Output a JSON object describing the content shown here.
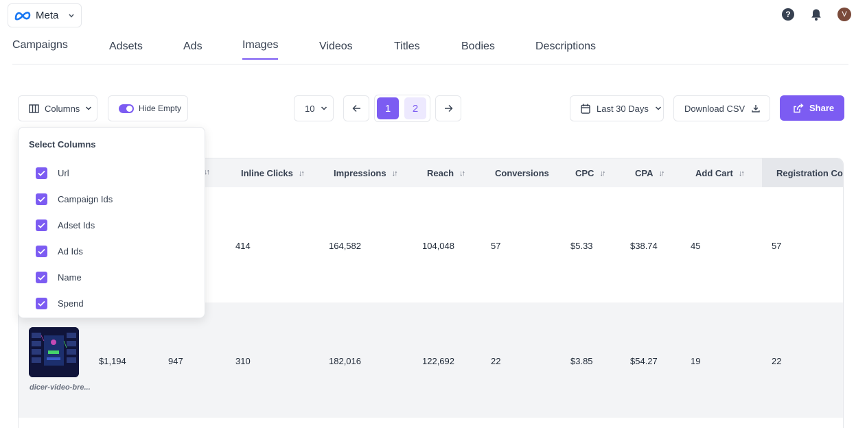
{
  "brand": {
    "name": "Meta"
  },
  "header": {
    "avatar_initial": "V",
    "help_glyph": "?"
  },
  "tabs": [
    {
      "label": "Campaigns"
    },
    {
      "label": "Adsets"
    },
    {
      "label": "Ads"
    },
    {
      "label": "Images",
      "active": true
    },
    {
      "label": "Videos"
    },
    {
      "label": "Titles"
    },
    {
      "label": "Bodies"
    },
    {
      "label": "Descriptions"
    }
  ],
  "toolbar": {
    "columns_label": "Columns",
    "hide_empty_label": "Hide Empty",
    "hide_empty_on": true,
    "per_page": "10",
    "pages": [
      "1",
      "2"
    ],
    "current_page": "1",
    "date_range": "Last 30 Days",
    "download_label": "Download CSV",
    "share_label": "Share"
  },
  "columns_dropdown": {
    "title": "Select Columns",
    "items": [
      {
        "label": "Url",
        "checked": true
      },
      {
        "label": "Campaign Ids",
        "checked": true
      },
      {
        "label": "Adset Ids",
        "checked": true
      },
      {
        "label": "Ad Ids",
        "checked": true
      },
      {
        "label": "Name",
        "checked": true
      },
      {
        "label": "Spend",
        "checked": true
      }
    ]
  },
  "table": {
    "headers": [
      "Inline Clicks",
      "Impressions",
      "Reach",
      "Conversions",
      "CPC",
      "CPA",
      "Add Cart",
      "Registration Cor"
    ],
    "rows": [
      {
        "spend": "",
        "col3": "",
        "inline_clicks": "414",
        "impressions": "164,582",
        "reach": "104,048",
        "conversions": "57",
        "cpc": "$5.33",
        "cpa": "$38.74",
        "add_cart": "45",
        "registration": "57"
      },
      {
        "thumb_name": "dicer-video-bre...",
        "spend": "$1,194",
        "col3": "947",
        "inline_clicks": "310",
        "impressions": "182,016",
        "reach": "122,692",
        "conversions": "22",
        "cpc": "$3.85",
        "cpa": "$54.27",
        "add_cart": "19",
        "registration": "22"
      }
    ]
  },
  "colors": {
    "accent": "#7c5cf2",
    "accent_light": "#ede9fe",
    "row_alt": "#f3f4f6"
  }
}
